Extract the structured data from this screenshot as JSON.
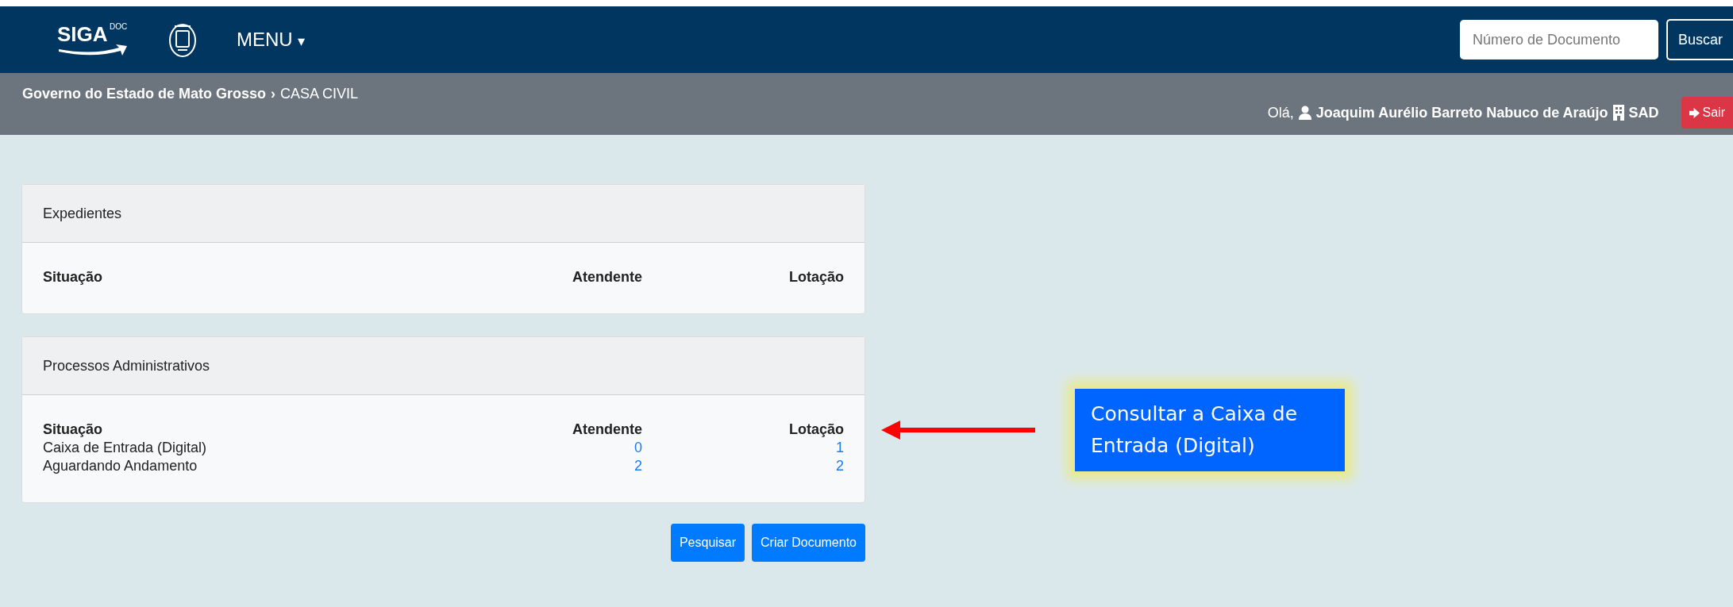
{
  "navbar": {
    "logo_text": "SIGA",
    "logo_sup": "DOC",
    "menu": "MENU",
    "caret": "▾",
    "search": {
      "placeholder": "Número de Documento"
    },
    "search_button": "Buscar"
  },
  "subbar": {
    "breadcrumb": [
      "Governo do Estado de Mato Grosso",
      "CASA CIVIL"
    ],
    "separator": "›",
    "greeting": "Olá,",
    "user": "Joaquim Aurélio Barreto Nabuco de Araújo",
    "unit": "SAD",
    "logout": "Sair"
  },
  "panels": [
    {
      "title": "Expedientes",
      "columns": [
        "Situação",
        "Atendente",
        "Lotação"
      ]
    },
    {
      "title": "Processos Administrativos",
      "columns": [
        "Situação",
        "Atendente",
        "Lotação"
      ],
      "rows": [
        {
          "situation": "Caixa de Entrada (Digital)",
          "attendant": "0",
          "location": "1"
        },
        {
          "situation": "Aguardando Andamento",
          "attendant": "2",
          "location": "2"
        }
      ]
    }
  ],
  "buttons": [
    "Pesquisar",
    "Criar Documento"
  ],
  "callout": {
    "text": "Consultar a Caixa de Entrada (Digital)"
  }
}
